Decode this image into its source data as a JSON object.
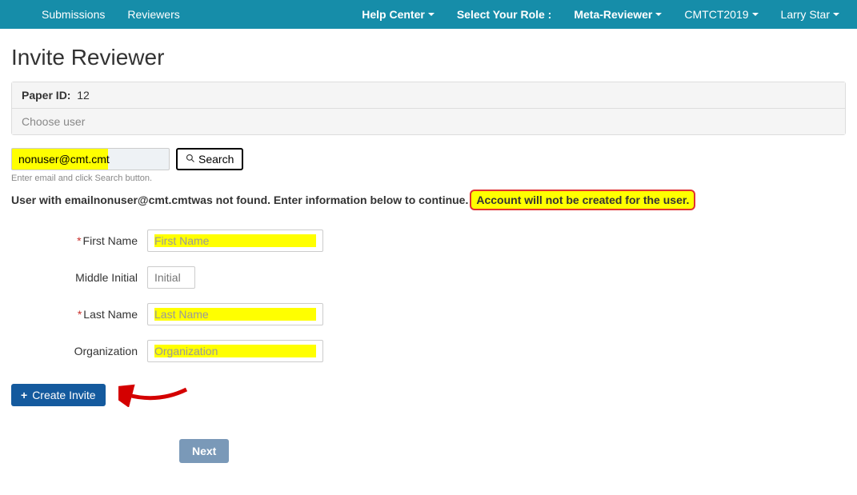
{
  "nav": {
    "left": [
      {
        "label": "Submissions"
      },
      {
        "label": "Reviewers"
      }
    ],
    "help": "Help Center",
    "select_role": "Select Your Role :",
    "role": "Meta-Reviewer",
    "conference": "CMTCT2019",
    "user": "Larry Star"
  },
  "title": "Invite Reviewer",
  "paper_id_label": "Paper ID:",
  "paper_id": "12",
  "choose_user": "Choose user",
  "search": {
    "value": "nonuser@cmt.cmt",
    "button": "Search",
    "help": "Enter email and click Search button."
  },
  "not_found_prefix": "User with email ",
  "not_found_email": "nonuser@cmt.cmt",
  "not_found_mid": " was not found. Enter information below to continue.",
  "callout": "Account will not be created for the user.",
  "form": {
    "first_name_label": "First Name",
    "first_name_ph": "First Name",
    "middle_label": "Middle Initial",
    "middle_ph": "Initial",
    "last_name_label": "Last Name",
    "last_name_ph": "Last Name",
    "org_label": "Organization",
    "org_ph": "Organization"
  },
  "create_invite": "Create Invite",
  "next": "Next"
}
